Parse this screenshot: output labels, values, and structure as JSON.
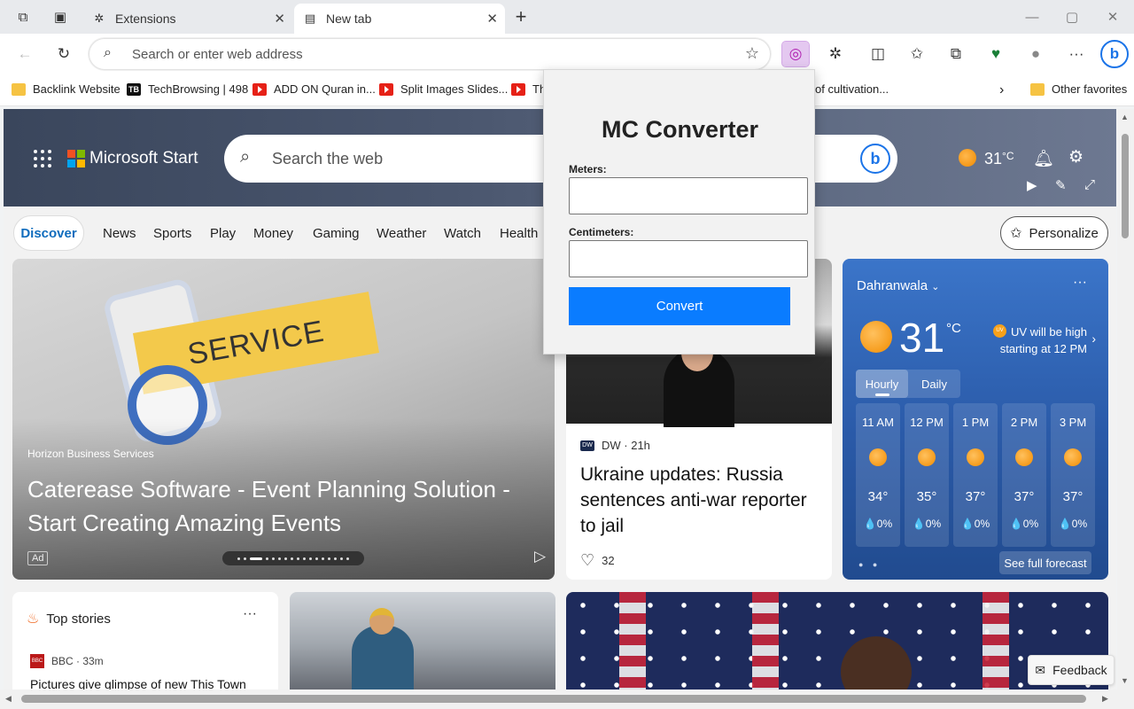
{
  "tabs": [
    {
      "label": "Extensions",
      "icon": "puzzle-icon",
      "active": false
    },
    {
      "label": "New tab",
      "icon": "new-tab-icon",
      "active": true
    }
  ],
  "toolbar": {
    "address_placeholder": "Search or enter web address"
  },
  "bookmarks": [
    {
      "label": "Backlink Website",
      "icon": "folder-icon"
    },
    {
      "label": "TechBrowsing | 498",
      "icon": "tb-favicon"
    },
    {
      "label": "ADD ON Quran in...",
      "icon": "youtube-icon"
    },
    {
      "label": "Split Images Slides...",
      "icon": "youtube-icon"
    },
    {
      "label": "Th",
      "icon": "youtube-icon"
    },
    {
      "label": "of cultivation...",
      "icon": "none"
    }
  ],
  "other_favorites": "Other favorites",
  "header": {
    "brand": "Microsoft Start",
    "search_placeholder": "Search the web",
    "temperature": "31",
    "temp_unit": "°C"
  },
  "nav": {
    "active": "Discover",
    "items": [
      "News",
      "Sports",
      "Play",
      "Money",
      "Gaming",
      "Weather",
      "Watch",
      "Health"
    ],
    "personalize": "Personalize"
  },
  "promo": {
    "banner_text": "SERVICE",
    "sponsor": "Horizon Business Services",
    "headline": "Caterease Software - Event Planning Solution - Start Creating Amazing Events",
    "ad_label": "Ad"
  },
  "news_card": {
    "source": "DW · 21h",
    "source_logo": "DW",
    "title": "Ukraine updates: Russia sentences anti-war reporter to jail",
    "likes": "32"
  },
  "weather": {
    "location": "Dahranwala",
    "temp": "31",
    "unit": "°C",
    "uv_badge": "UV",
    "uv_text": "UV will be high starting at 12 PM",
    "tab_hourly": "Hourly",
    "tab_daily": "Daily",
    "hours": [
      {
        "time": "11 AM",
        "temp": "34°",
        "precip": "💧0%"
      },
      {
        "time": "12 PM",
        "temp": "35°",
        "precip": "💧0%"
      },
      {
        "time": "1 PM",
        "temp": "37°",
        "precip": "💧0%"
      },
      {
        "time": "2 PM",
        "temp": "37°",
        "precip": "💧0%"
      },
      {
        "time": "3 PM",
        "temp": "37°",
        "precip": "💧0%"
      }
    ],
    "full_forecast": "See full forecast"
  },
  "top_stories": {
    "title": "Top stories",
    "source": "BBC · 33m",
    "source_logo": "BBC NEWS",
    "headline": "Pictures give glimpse of new This Town"
  },
  "feedback": "Feedback",
  "popup": {
    "title": "MC Converter",
    "meters_label": "Meters:",
    "meters_value": "",
    "centimeters_label": "Centimeters:",
    "centimeters_value": "",
    "convert_label": "Convert"
  },
  "colors": {
    "accent": "#0f6cbd",
    "convert_button": "#0a7cff",
    "extension_highlight": "#e4c8f0",
    "weather_card": "#2a5aa8"
  }
}
